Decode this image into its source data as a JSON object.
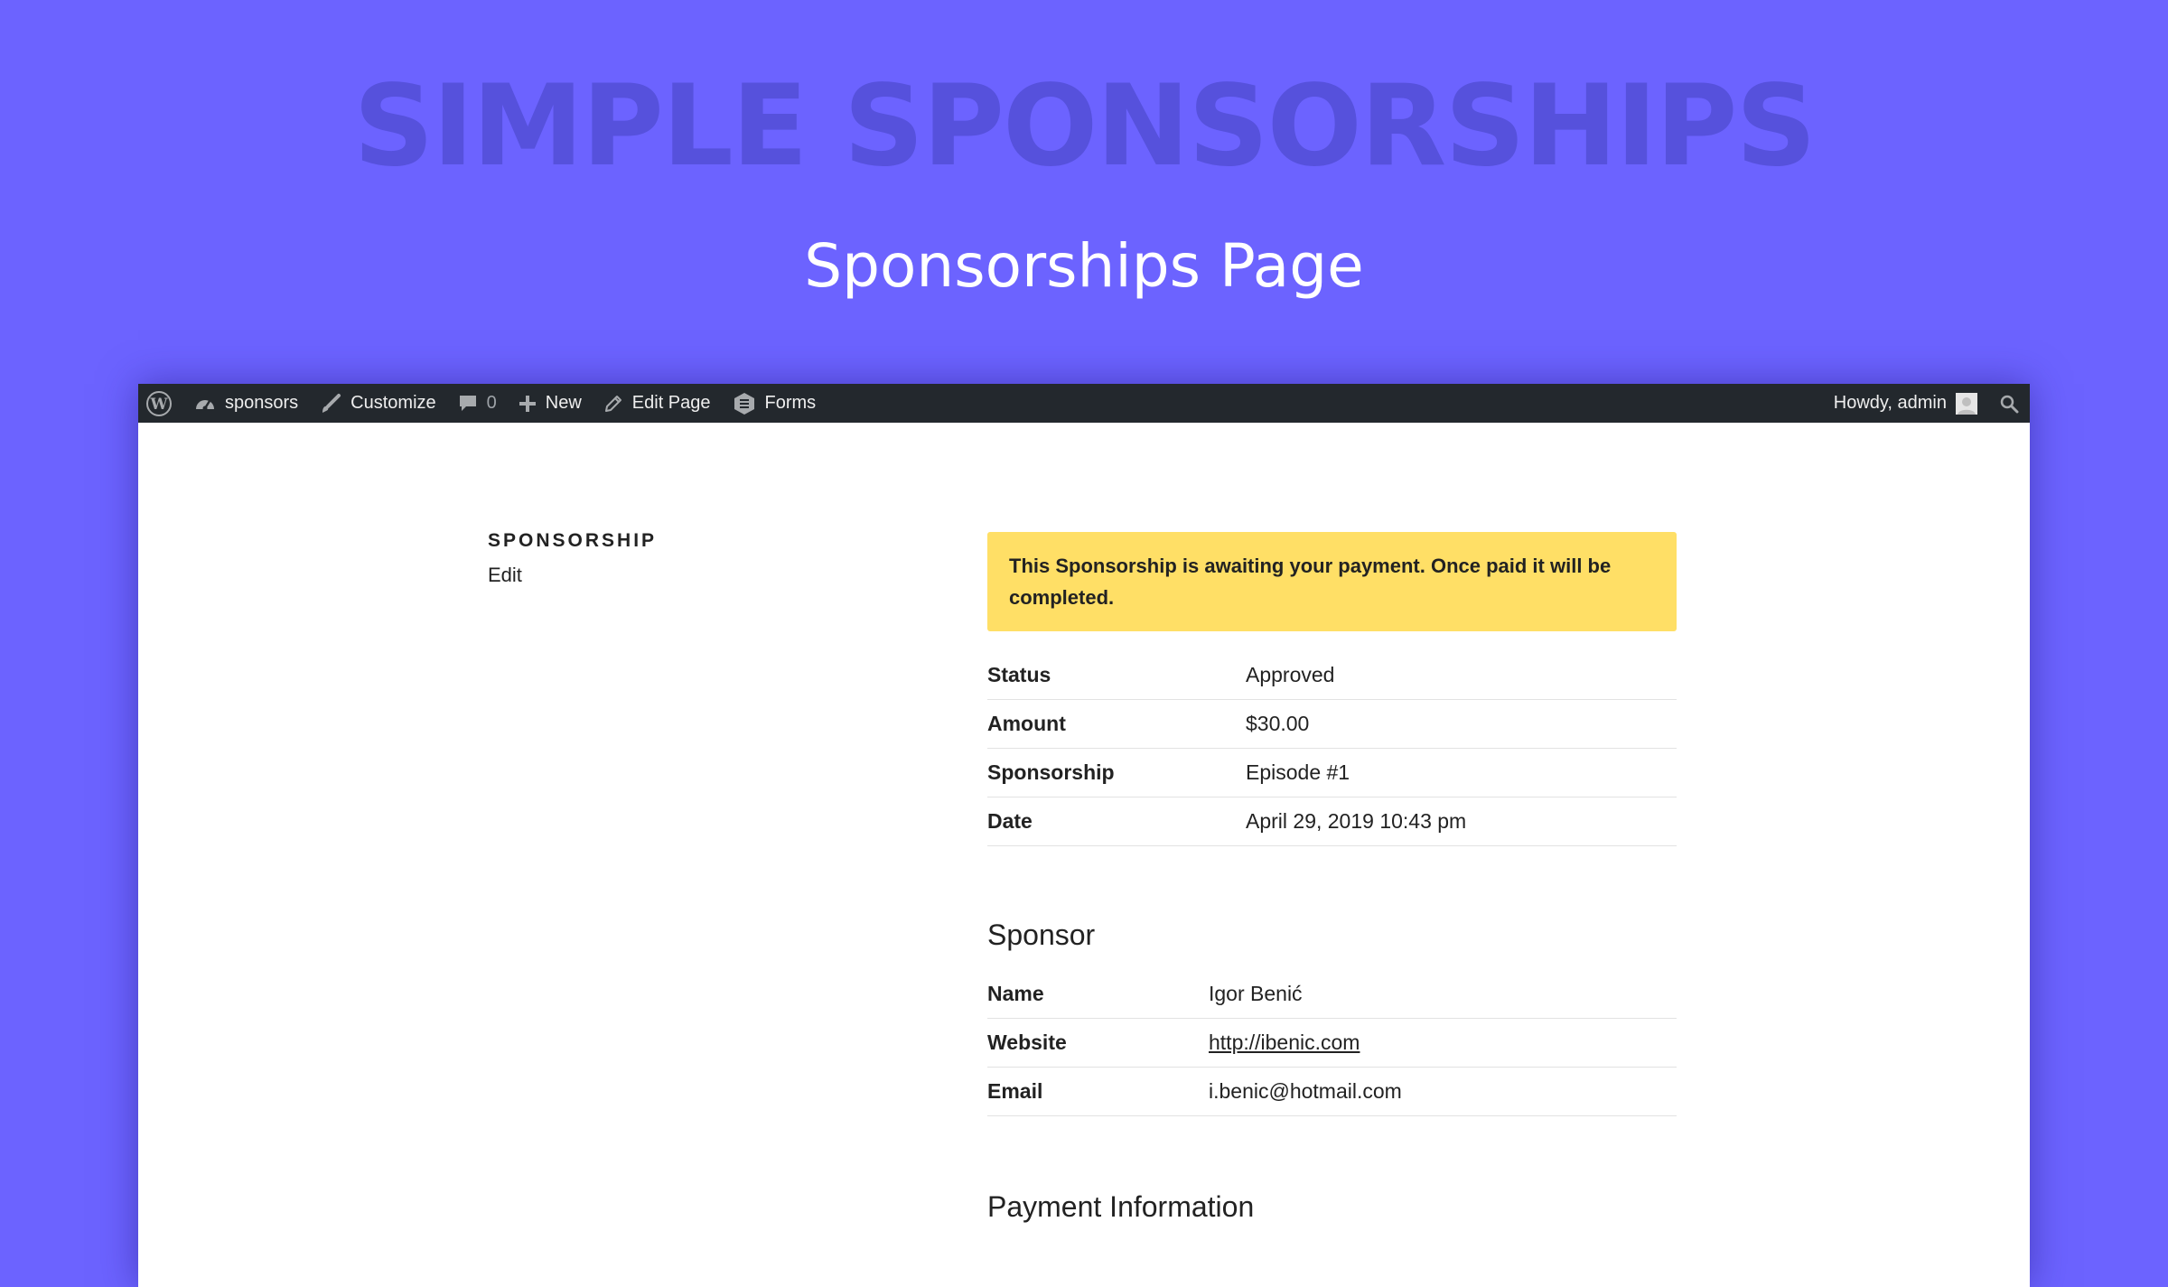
{
  "hero": {
    "title": "SIMPLE SPONSORSHIPS",
    "subtitle": "Sponsorships Page"
  },
  "admin_bar": {
    "site_name": "sponsors",
    "customize": "Customize",
    "comments_count": "0",
    "new": "New",
    "edit_page": "Edit Page",
    "forms": "Forms",
    "howdy": "Howdy, admin"
  },
  "sidebar": {
    "section_label": "SPONSORSHIP",
    "edit_link": "Edit"
  },
  "notice": {
    "text": "This Sponsorship is awaiting your payment. Once paid it will be completed."
  },
  "details": [
    {
      "label": "Status",
      "value": "Approved"
    },
    {
      "label": "Amount",
      "value": "$30.00"
    },
    {
      "label": "Sponsorship",
      "value": "Episode #1"
    },
    {
      "label": "Date",
      "value": "April 29, 2019 10:43 pm"
    }
  ],
  "sponsor": {
    "heading": "Sponsor",
    "fields": [
      {
        "label": "Name",
        "value": "Igor Benić"
      },
      {
        "label": "Website",
        "value": "http://ibenic.com"
      },
      {
        "label": "Email",
        "value": "i.benic@hotmail.com"
      }
    ]
  },
  "payment": {
    "heading": "Payment Information"
  },
  "colors": {
    "background": "#6c63ff",
    "hero_title": "#5651dc",
    "admin_bar": "#23282d",
    "notice": "#ffdf66"
  }
}
